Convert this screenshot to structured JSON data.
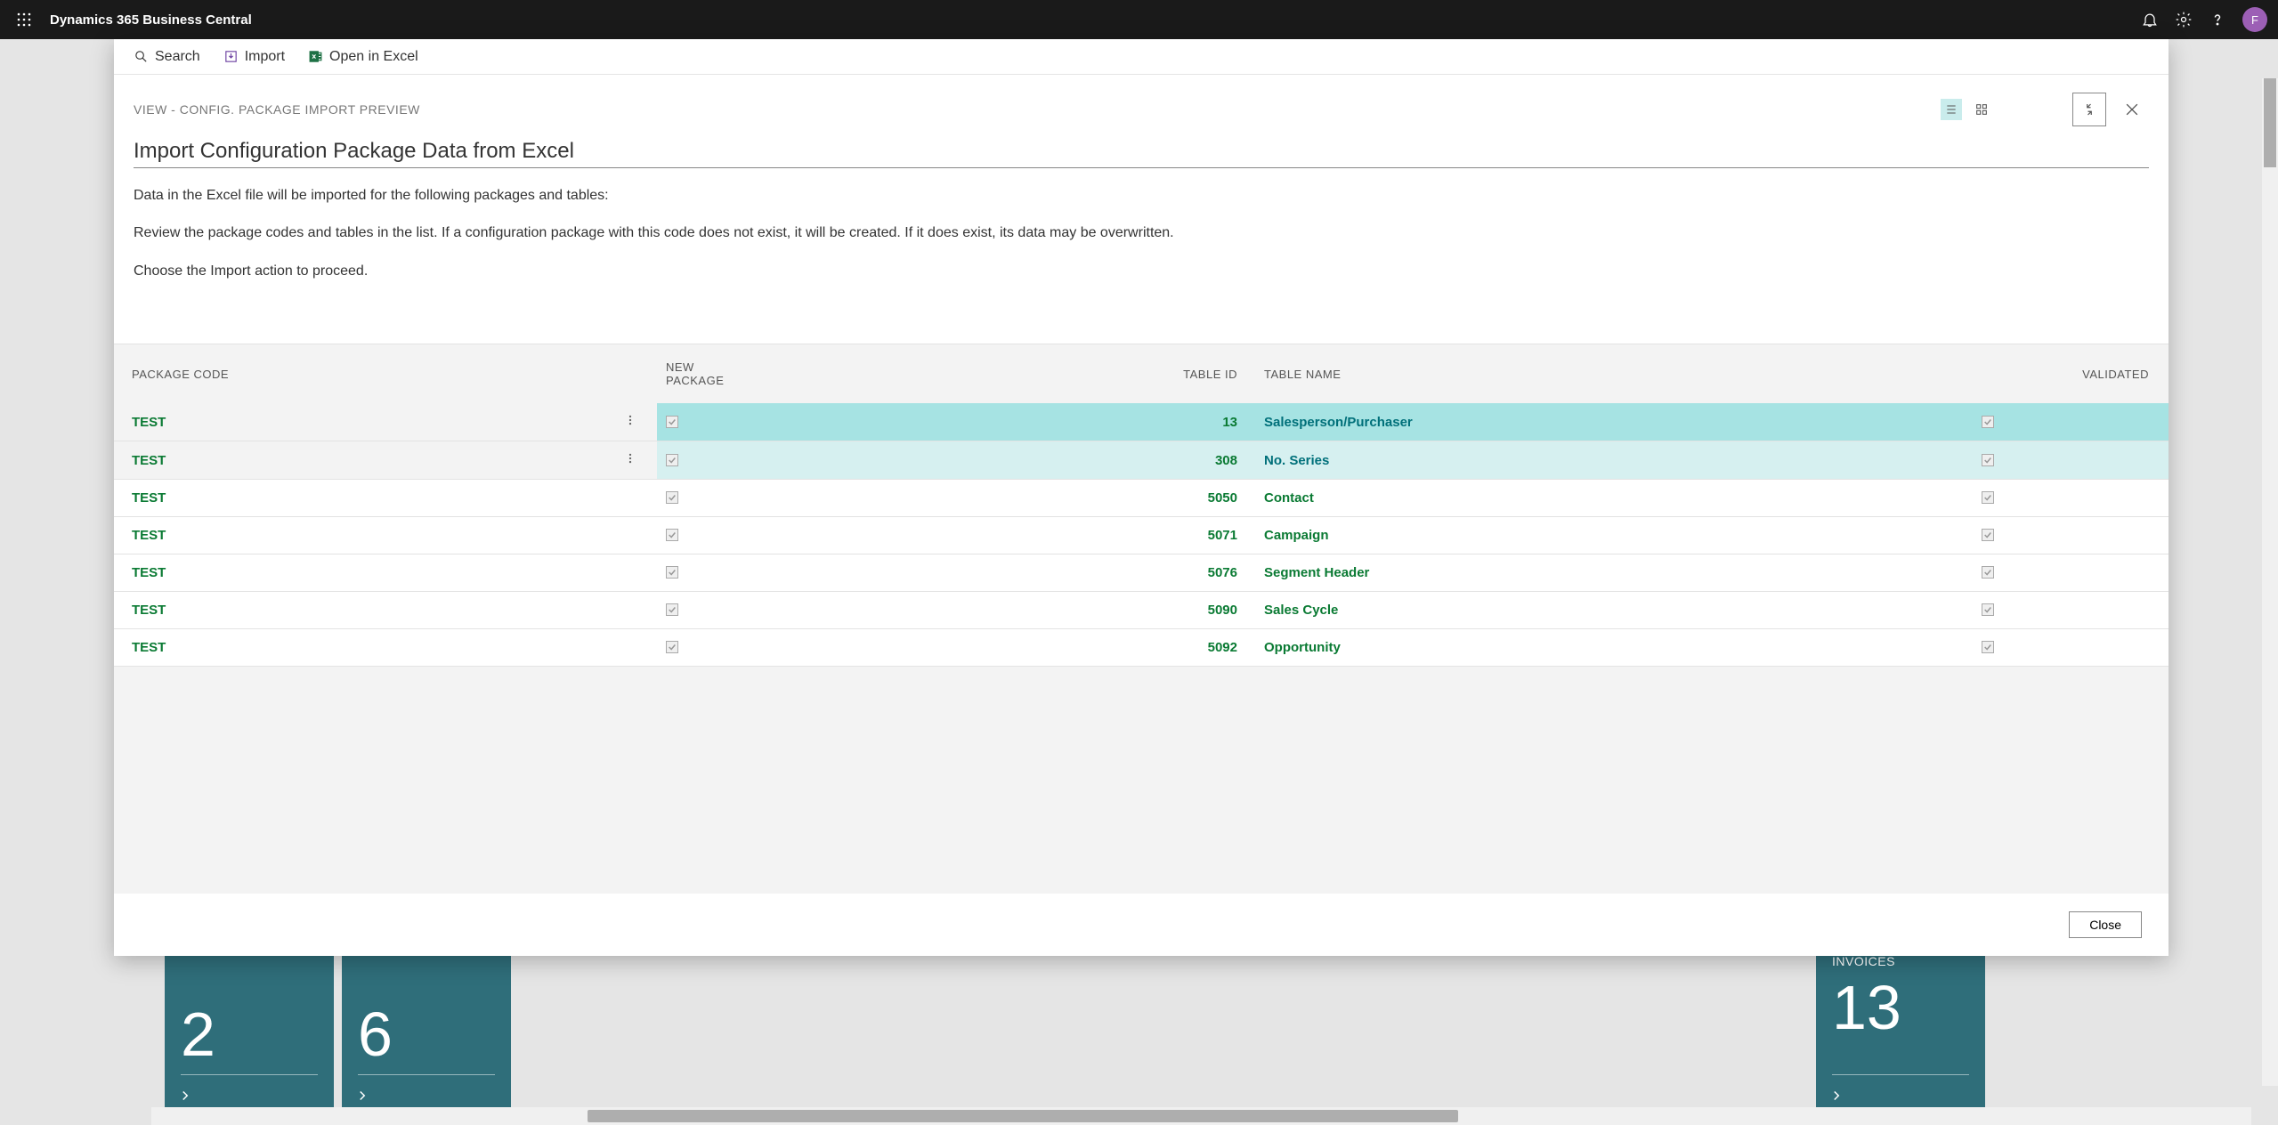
{
  "app": {
    "title": "Dynamics 365 Business Central",
    "avatar_letter": "F"
  },
  "actions": {
    "search": "Search",
    "import": "Import",
    "open_excel": "Open in Excel"
  },
  "breadcrumb": "VIEW - CONFIG. PACKAGE IMPORT PREVIEW",
  "page_title": "Import Configuration Package Data from Excel",
  "descriptions": [
    "Data in the Excel file will be imported for the following packages and tables:",
    "Review the package codes and tables in the list. If a configuration package with this code does not exist, it will be created. If it does exist, its data may be overwritten.",
    "Choose the Import action to proceed."
  ],
  "columns": {
    "package_code": "PACKAGE CODE",
    "new_package": "NEW PACKAGE",
    "table_id": "TABLE ID",
    "table_name": "TABLE NAME",
    "validated": "VALIDATED"
  },
  "rows": [
    {
      "package_code": "TEST",
      "new_package": true,
      "table_id": "13",
      "table_name": "Salesperson/Purchaser",
      "validated": true,
      "highlight": 0,
      "show_menu": true
    },
    {
      "package_code": "TEST",
      "new_package": true,
      "table_id": "308",
      "table_name": "No. Series",
      "validated": true,
      "highlight": 1,
      "show_menu": true
    },
    {
      "package_code": "TEST",
      "new_package": true,
      "table_id": "5050",
      "table_name": "Contact",
      "validated": true,
      "highlight": null,
      "show_menu": false
    },
    {
      "package_code": "TEST",
      "new_package": true,
      "table_id": "5071",
      "table_name": "Campaign",
      "validated": true,
      "highlight": null,
      "show_menu": false
    },
    {
      "package_code": "TEST",
      "new_package": true,
      "table_id": "5076",
      "table_name": "Segment Header",
      "validated": true,
      "highlight": null,
      "show_menu": false
    },
    {
      "package_code": "TEST",
      "new_package": true,
      "table_id": "5090",
      "table_name": "Sales Cycle",
      "validated": true,
      "highlight": null,
      "show_menu": false
    },
    {
      "package_code": "TEST",
      "new_package": true,
      "table_id": "5092",
      "table_name": "Opportunity",
      "validated": true,
      "highlight": null,
      "show_menu": false
    }
  ],
  "footer": {
    "close": "Close"
  },
  "tiles_left": [
    {
      "number": "2"
    },
    {
      "number": "6"
    }
  ],
  "tiles_right": [
    {
      "label": "INVOICES",
      "number": "13"
    }
  ]
}
